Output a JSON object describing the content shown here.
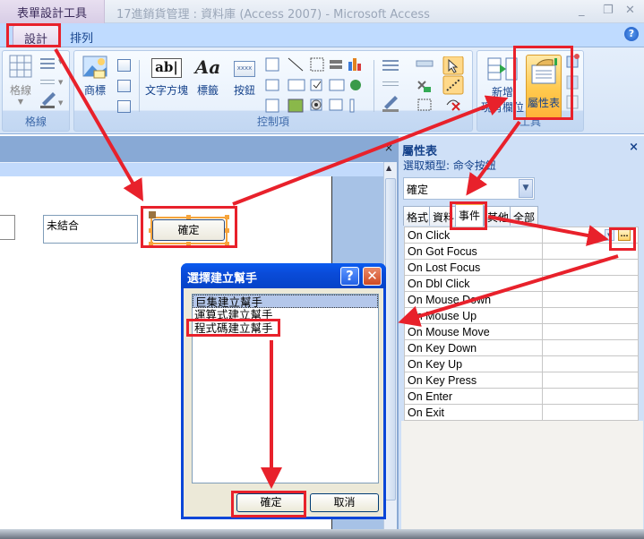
{
  "titlebar": {
    "context_tab": "表單設計工具",
    "window_title": "17進銷貨管理 : 資料庫 (Access 2007) - Microsoft Access",
    "minimize": "_",
    "restore": "❐",
    "close": "✕"
  },
  "ribbon_tabs": [
    {
      "label": "設計",
      "active": true
    },
    {
      "label": "排列",
      "active": false
    }
  ],
  "help": "?",
  "ribbon": {
    "groups": [
      {
        "label": "格線",
        "buttons": [
          {
            "label": "格線"
          }
        ]
      },
      {
        "label": "控制項",
        "buttons": [
          {
            "label": "商標"
          },
          {
            "label": "文字方塊"
          },
          {
            "label": "標籤"
          },
          {
            "label": "按鈕"
          }
        ]
      },
      {
        "label": "工具",
        "buttons": [
          {
            "label": "新增\n現有欄位"
          },
          {
            "label": "屬性表"
          }
        ]
      }
    ],
    "textbox_glyph": "ab|",
    "label_glyph": "Aa",
    "button_glyph": "xxxx",
    "add_fields_line1": "新增",
    "add_fields_line2": "現有欄位"
  },
  "form": {
    "unbound_text": "未結合",
    "command_button": "確定",
    "close": "×"
  },
  "property_sheet": {
    "title": "屬性表",
    "close": "×",
    "selection_type": "選取類型:  命令按鈕",
    "selected_object": "確定",
    "tabs": [
      {
        "label": "格式",
        "active": false
      },
      {
        "label": "資料",
        "active": false
      },
      {
        "label": "事件",
        "active": true
      },
      {
        "label": "其他",
        "active": false
      },
      {
        "label": "全部",
        "active": false
      }
    ],
    "events": [
      {
        "name": "On Click",
        "value": ""
      },
      {
        "name": "On Got Focus",
        "value": ""
      },
      {
        "name": "On Lost Focus",
        "value": ""
      },
      {
        "name": "On Dbl Click",
        "value": ""
      },
      {
        "name": "On Mouse Down",
        "value": ""
      },
      {
        "name": "On Mouse Up",
        "value": ""
      },
      {
        "name": "On Mouse Move",
        "value": ""
      },
      {
        "name": "On Key Down",
        "value": ""
      },
      {
        "name": "On Key Up",
        "value": ""
      },
      {
        "name": "On Key Press",
        "value": ""
      },
      {
        "name": "On Enter",
        "value": ""
      },
      {
        "name": "On Exit",
        "value": ""
      }
    ],
    "builder_button": "..."
  },
  "dialog": {
    "title": "選擇建立幫手",
    "help": "?",
    "close": "✕",
    "options": [
      {
        "label": "巨集建立幫手",
        "selected": true
      },
      {
        "label": "運算式建立幫手",
        "selected": false
      },
      {
        "label": "程式碼建立幫手",
        "selected": false
      }
    ],
    "ok": "確定",
    "cancel": "取消"
  },
  "annotation_color": "#e8212b"
}
